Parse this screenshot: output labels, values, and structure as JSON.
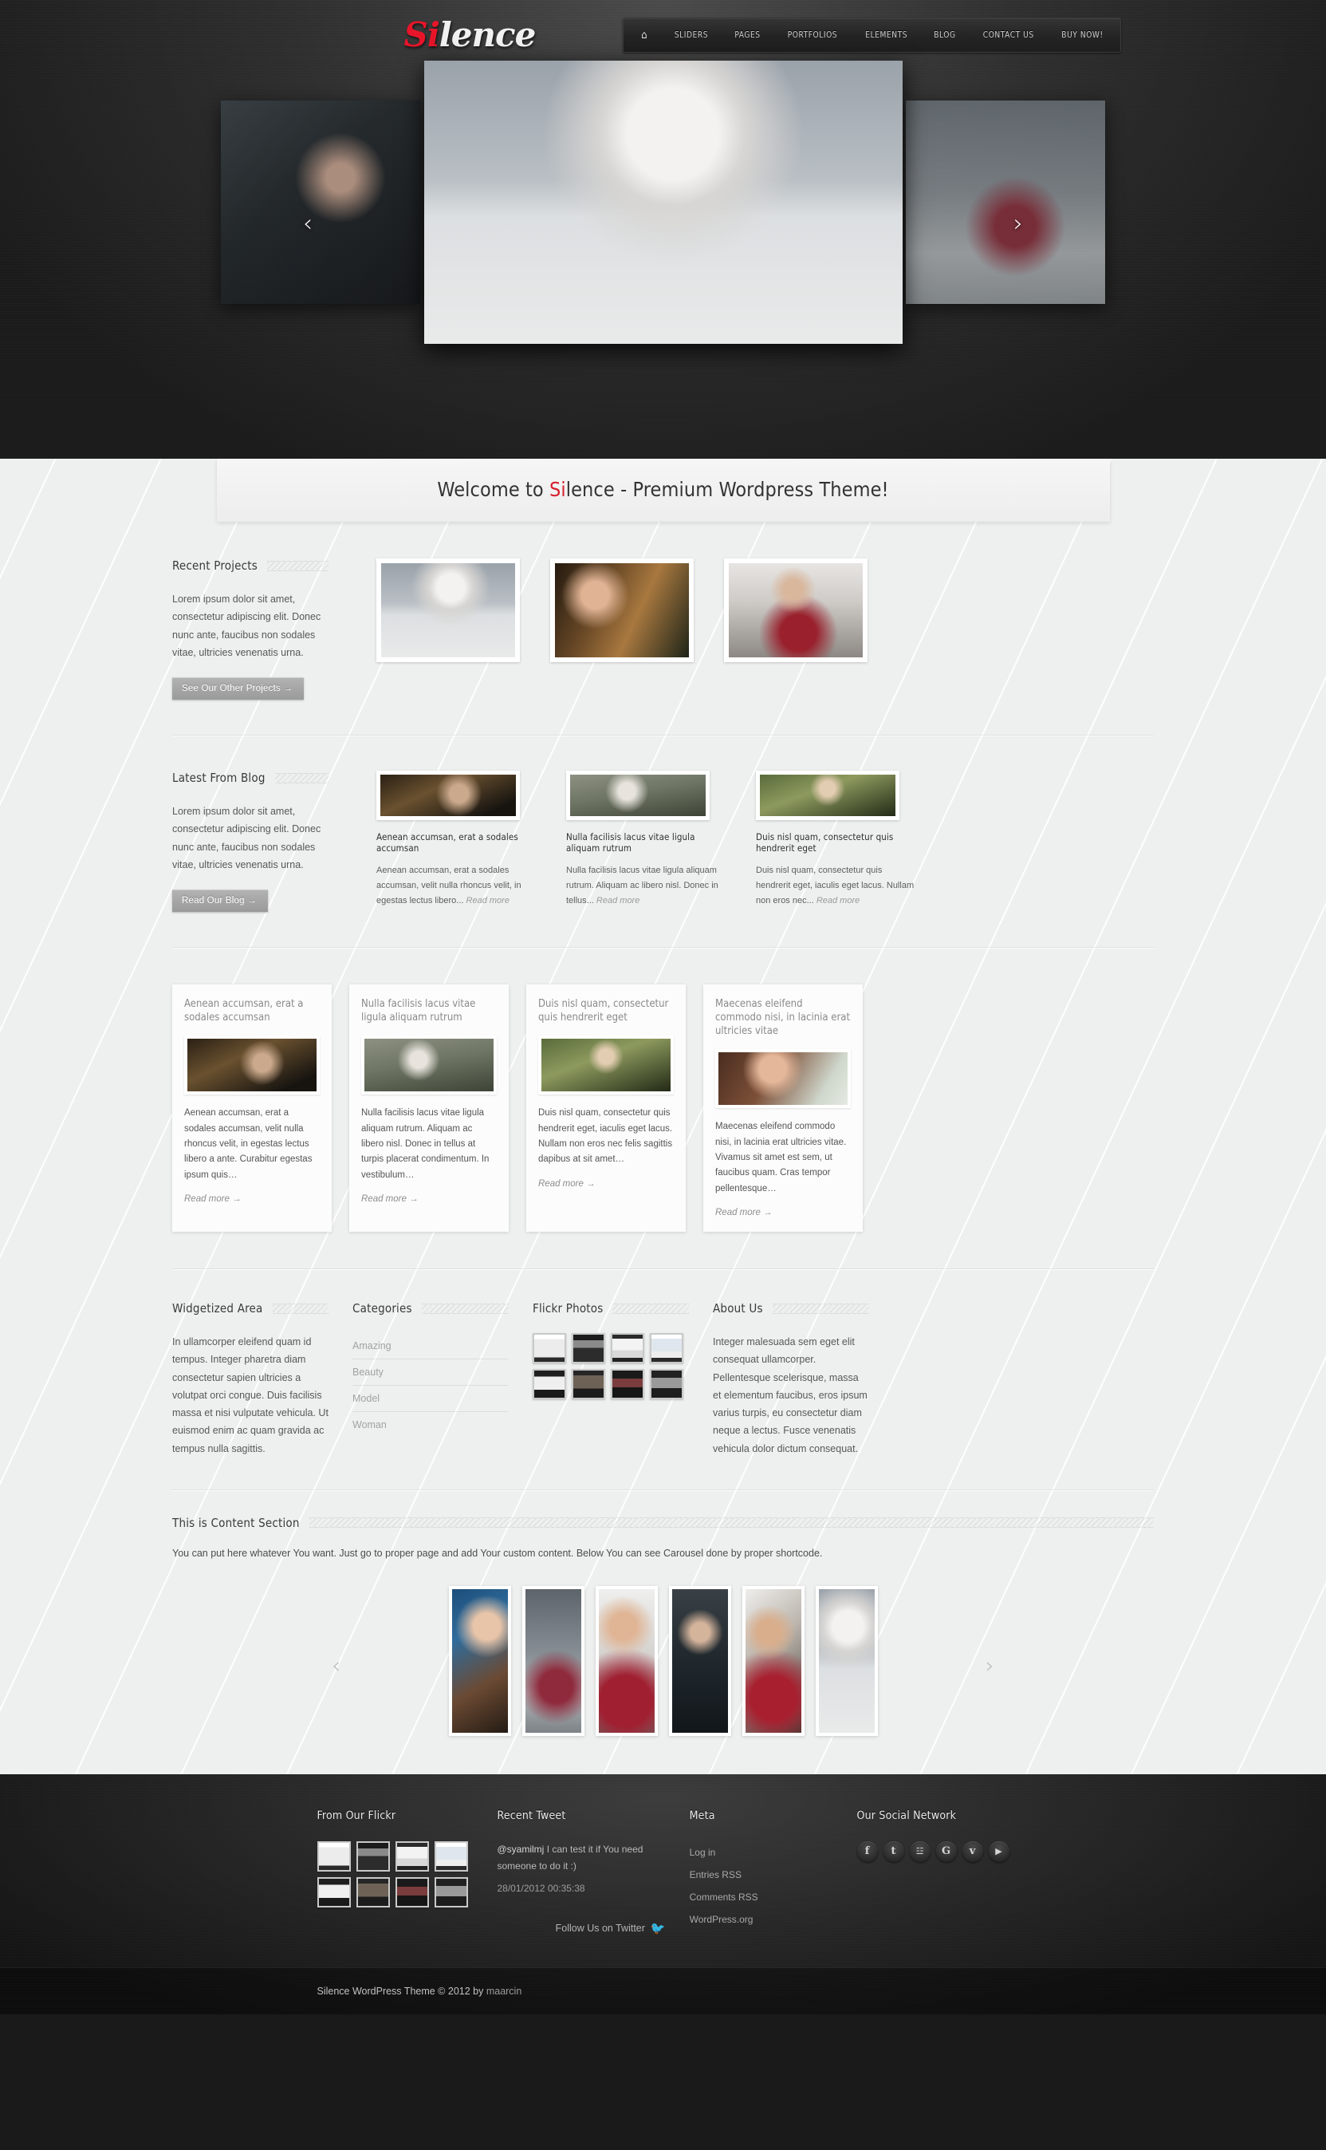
{
  "header": {
    "logo": {
      "red_part": "Si",
      "white_part": "lence"
    },
    "nav": [
      {
        "label": "",
        "icon": "home-icon",
        "name": "home"
      },
      {
        "label": "SLIDERS",
        "name": "sliders"
      },
      {
        "label": "PAGES",
        "name": "pages"
      },
      {
        "label": "PORTFOLIOS",
        "name": "portfolios"
      },
      {
        "label": "ELEMENTS",
        "name": "elements"
      },
      {
        "label": "BLOG",
        "name": "blog"
      },
      {
        "label": "CONTACT US",
        "name": "contact-us"
      },
      {
        "label": "BUY NOW!",
        "name": "buy-now"
      }
    ]
  },
  "hero": {
    "prev_arrow": "‹",
    "next_arrow": "›",
    "slides": [
      {
        "photo": "ph-dark-hair",
        "position": "left"
      },
      {
        "photo": "ph-bw-curl",
        "position": "center"
      },
      {
        "photo": "ph-beach-red",
        "position": "right"
      }
    ]
  },
  "welcome": {
    "prefix": "Welcome to ",
    "highlight": "Si",
    "suffix": "lence - Premium Wordpress Theme!"
  },
  "recent_projects": {
    "title": "Recent Projects",
    "text": "Lorem ipsum dolor sit amet, consectetur adipiscing elit. Donec nunc ante, faucibus non sodales vitae, ultricies venenatis urna.",
    "button": "See Our Other Projects  →",
    "items": [
      {
        "photo": "ph-bw-curl"
      },
      {
        "photo": "ph-brown-hair"
      },
      {
        "photo": "ph-red-dress"
      }
    ]
  },
  "latest_blog": {
    "title": "Latest From Blog",
    "text": "Lorem ipsum dolor sit amet, consectetur adipiscing elit. Donec nunc ante, faucibus non sodales vitae, ultricies venenatis urna.",
    "button": "Read Our Blog  →",
    "posts": [
      {
        "photo": "ph-bed",
        "title": "Aenean accumsan, erat a sodales accumsan",
        "excerpt": "Aenean accumsan, erat a sodales accumsan, velit nulla rhoncus velit, in egestas lectus libero... ",
        "read_more": "Read more"
      },
      {
        "photo": "ph-forest",
        "title": "Nulla facilisis lacus vitae ligula aliquam rutrum",
        "excerpt": "Nulla facilisis lacus vitae ligula aliquam rutrum. Aliquam ac libero nisl. Donec in tellus... ",
        "read_more": "Read more"
      },
      {
        "photo": "ph-green-dress",
        "title": "Duis nisl quam, consectetur quis hendrerit eget",
        "excerpt": "Duis nisl quam, consectetur quis hendrerit eget, iaculis eget lacus. Nullam non eros nec... ",
        "read_more": "Read more"
      }
    ]
  },
  "portfolio_cards": [
    {
      "title": "Aenean accumsan, erat a sodales accumsan",
      "photo": "ph-bed",
      "excerpt": "Aenean accumsan, erat a sodales accumsan, velit nulla rhoncus velit, in egestas lectus libero a ante. Curabitur egestas ipsum quis…",
      "read_more": "Read more →"
    },
    {
      "title": "Nulla facilisis lacus vitae ligula aliquam rutrum",
      "photo": "ph-forest",
      "excerpt": "Nulla facilisis lacus vitae ligula aliquam rutrum. Aliquam ac libero nisl. Donec in tellus at turpis placerat condimentum. In vestibulum…",
      "read_more": "Read more →"
    },
    {
      "title": "Duis nisl quam, consectetur quis hendrerit eget",
      "photo": "ph-green-dress",
      "excerpt": "Duis nisl quam, consectetur quis hendrerit eget, iaculis eget lacus. Nullam non eros nec felis sagittis dapibus at sit amet…",
      "read_more": "Read more →"
    },
    {
      "title": "Maecenas eleifend commodo nisi, in lacinia erat ultricies vitae",
      "photo": "ph-necklace",
      "excerpt": "Maecenas eleifend commodo nisi, in lacinia erat ultricies vitae. Vivamus sit amet est sem, ut faucibus quam. Cras tempor pellentesque…",
      "read_more": "Read more →"
    }
  ],
  "widgets": {
    "widgetized": {
      "title": "Widgetized Area",
      "text": "In ullamcorper eleifend quam id tempus. Integer pharetra diam consectetur sapien ultricies a volutpat orci congue. Duis facilisis massa et nisi vulputate vehicula. Ut euismod enim ac quam gravida ac tempus nulla sagittis."
    },
    "categories": {
      "title": "Categories",
      "items": [
        "Amazing",
        "Beauty",
        "Model",
        "Woman"
      ]
    },
    "flickr": {
      "title": "Flickr Photos",
      "thumbs": [
        "fk-a",
        "fk-b",
        "fk-c",
        "fk-d",
        "fk-e",
        "fk-f",
        "fk-g",
        "fk-h"
      ]
    },
    "about": {
      "title": "About Us",
      "text": "Integer malesuada sem eget elit consequat ullamcorper. Pellentesque scelerisque, massa et elementum faucibus, eros ipsum varius turpis, eu consectetur diam neque a lectus. Fusce venenatis vehicula dolor dictum consequat."
    }
  },
  "content_section": {
    "title": "This is Content Section",
    "text": "You can put here whatever You want. Just go to proper page and add Your custom content. Below You can see Carousel done by proper shortcode.",
    "carousel": {
      "prev_arrow": "‹",
      "next_arrow": "›",
      "items": [
        {
          "photo": "ph-blue-scarf"
        },
        {
          "photo": "ph-sea-red"
        },
        {
          "photo": "ph-red-veil"
        },
        {
          "photo": "ph-black-hair"
        },
        {
          "photo": "ph-wind-red"
        },
        {
          "photo": "ph-bw-curl"
        }
      ]
    }
  },
  "footer": {
    "flickr": {
      "title": "From Our Flickr",
      "thumbs": [
        "fk-a",
        "fk-b",
        "fk-c",
        "fk-d",
        "fk-e",
        "fk-f",
        "fk-g",
        "fk-h"
      ]
    },
    "tweet": {
      "title": "Recent Tweet",
      "handle": "@syamilmj",
      "body": " I can test it if You need someone to do it :)",
      "date": "28/01/2012 00:35:38",
      "follow_label": "Follow Us on Twitter",
      "bird_icon": "twitter-bird-icon"
    },
    "meta": {
      "title": "Meta",
      "items": [
        "Log in",
        "Entries RSS",
        "Comments RSS",
        "WordPress.org"
      ]
    },
    "social": {
      "title": "Our Social Network",
      "icons": [
        {
          "name": "facebook-icon",
          "glyph": "f"
        },
        {
          "name": "twitter-icon",
          "glyph": "t"
        },
        {
          "name": "rss-icon",
          "glyph": "☳"
        },
        {
          "name": "google-icon",
          "glyph": "G"
        },
        {
          "name": "vimeo-icon",
          "glyph": "v"
        },
        {
          "name": "youtube-icon",
          "glyph": "▶"
        }
      ]
    },
    "copyright_main": "Silence WordPress Theme © 2012 by ",
    "copyright_author": "maarcin"
  }
}
